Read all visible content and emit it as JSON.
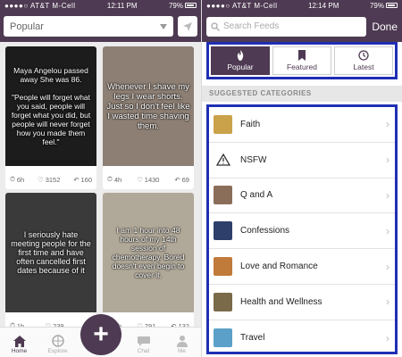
{
  "left": {
    "status": {
      "carrier": "AT&T M-Cell",
      "time": "12:11 PM",
      "battery": "79%"
    },
    "feed_selector": {
      "value": "Popular"
    },
    "cards": [
      {
        "text": "Maya Angelou passed away She was 86.\n\n\"People will forget what you said, people will forget what you did, but people will never forget how you made them feel.\"",
        "time": "6h",
        "likes": "3152",
        "replies": "160"
      },
      {
        "text": "Whenever I shave my legs I wear shorts. Just so I don't feel like I wasted time shaving them.",
        "time": "4h",
        "likes": "1430",
        "replies": "69"
      },
      {
        "text": "I seriously hate meeting people for the first time and have often cancelled first dates because of it",
        "time": "1h",
        "likes": "239",
        "replies": ""
      },
      {
        "text": "I am 1 hour into 48 hours of my 14th session of chemotherapy. Bored doesn't even begin to cover it.",
        "time": "4h",
        "likes": "791",
        "replies": "132"
      }
    ],
    "tabbar": {
      "home": "Home",
      "explore": "Explore",
      "compose": "+",
      "chat": "Chat",
      "me": "Me"
    }
  },
  "right": {
    "status": {
      "carrier": "AT&T M-Cell",
      "time": "12:14 PM",
      "battery": "79%"
    },
    "search": {
      "placeholder": "Search Feeds"
    },
    "done_label": "Done",
    "segments": [
      {
        "label": "Popular",
        "icon": "flame-icon"
      },
      {
        "label": "Featured",
        "icon": "ribbon-icon"
      },
      {
        "label": "Latest",
        "icon": "clock-icon"
      }
    ],
    "suggested_header": "SUGGESTED CATEGORIES",
    "categories": [
      {
        "label": "Faith",
        "color": "#c9a24a"
      },
      {
        "label": "NSFW",
        "color": "#ffffff"
      },
      {
        "label": "Q and A",
        "color": "#8a6e5a"
      },
      {
        "label": "Confessions",
        "color": "#2e3f6b"
      },
      {
        "label": "Love and Romance",
        "color": "#c07a3a"
      },
      {
        "label": "Health and Wellness",
        "color": "#7a6a4a"
      },
      {
        "label": "Travel",
        "color": "#5aa0c8"
      }
    ]
  },
  "colors": {
    "brand": "#4e3a52",
    "highlight": "#1f2fb4"
  }
}
